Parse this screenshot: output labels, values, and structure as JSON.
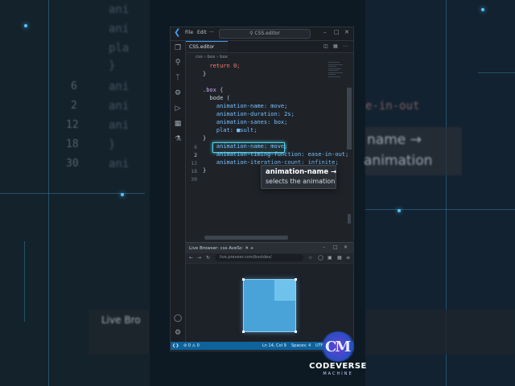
{
  "background": {
    "left_code_lines": [
      "ani",
      "ani",
      "pla",
      "}",
      "ani",
      "ani",
      "ani",
      "}",
      "ani"
    ],
    "left_line_numbers": [
      "6",
      "2",
      "12",
      "18",
      "30"
    ],
    "right_text": [
      "e-in-out",
      "name →",
      "animation"
    ],
    "bg_browser_tab": "Live Bro"
  },
  "titlebar": {
    "menu": [
      "File",
      "Edit",
      "···"
    ],
    "search": "CSS.editor"
  },
  "tabs": {
    "active": "CSS.editor"
  },
  "breadcrumb": "css  ›  box  ›  box",
  "editor": {
    "line_numbers": [
      "6",
      "2",
      "12",
      "18",
      "30"
    ],
    "lines": [
      {
        "text": "return 0;",
        "indent": 1
      },
      {
        "text": "}",
        "indent": 0
      },
      {
        "text": "",
        "indent": 0
      },
      {
        "text": ".box {",
        "indent": 0
      },
      {
        "text": "bode (",
        "indent": 1
      },
      {
        "text": "animation-name: move;",
        "indent": 2
      },
      {
        "text": "animation-duration: 2s;",
        "indent": 2
      },
      {
        "text": "animation-sanes: box;",
        "indent": 2
      },
      {
        "text": "plat: ■sult;",
        "indent": 2
      },
      {
        "text": "}",
        "indent": 0
      },
      {
        "text": "animation-name: move;",
        "indent": 2
      },
      {
        "text": "animation-timing-function: ease-in-out;",
        "indent": 2
      },
      {
        "text": "animation-iteration-count: infinite;",
        "indent": 2
      },
      {
        "text": "}",
        "indent": 0
      }
    ]
  },
  "tooltip": {
    "title": "animation-name →",
    "body": "selects the animation"
  },
  "browser": {
    "tab": "Live Browser: css AveSc·",
    "url": "live.preveer.com/bxstdex/"
  },
  "status": {
    "branch": "⊘ 0 ⚠ 0",
    "position": "Ln 14, Col 9",
    "spaces": "Spaces: 4",
    "encoding": "UTF-8"
  },
  "brand": {
    "name": "CODEVERSE",
    "sub": "MACHINE"
  },
  "colors": {
    "accent": "#3aa0ff",
    "status_bar": "#0e639c",
    "highlight": "#4fd1e6"
  }
}
